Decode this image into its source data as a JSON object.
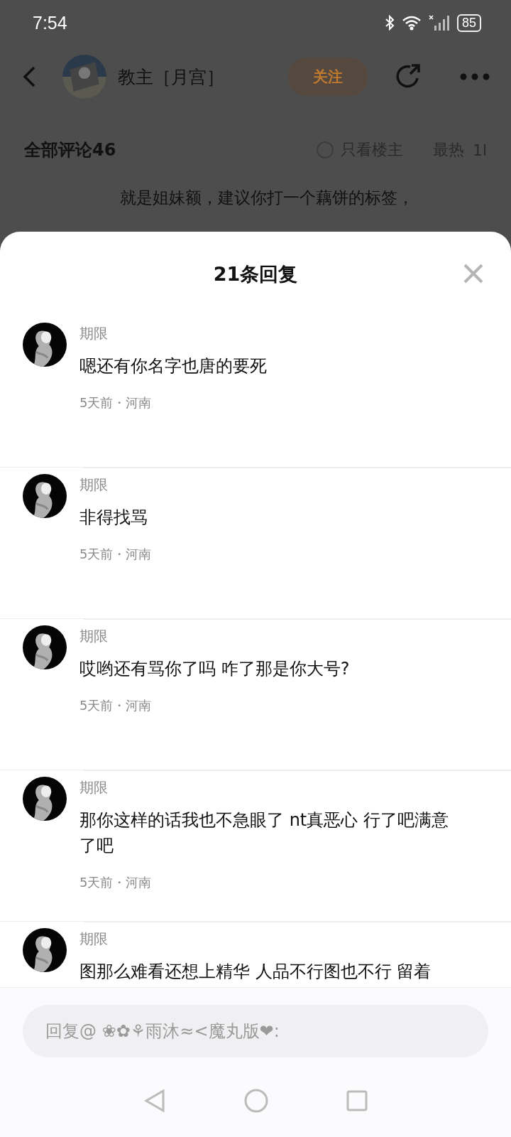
{
  "status_bar": {
    "time": "7:54",
    "battery": "85"
  },
  "header": {
    "author": "教主［月宫］",
    "follow_button": "关注"
  },
  "comments_bar": {
    "title": "全部评论46",
    "only_op": {
      "label": "只看楼主",
      "checked": false
    },
    "sort": "最热",
    "sort_cut": "1l"
  },
  "background_comment": {
    "lines": [
      "就是姐妹额，建议你打一个藕饼的标签，"
    ]
  },
  "sheet": {
    "title": "21条回复",
    "replies": [
      {
        "name": "期限",
        "text": "嗯还有你名字也唐的要死",
        "meta": "5天前・河南"
      },
      {
        "name": "期限",
        "text": "非得找骂",
        "meta": "5天前・河南"
      },
      {
        "name": "期限",
        "text": "哎哟还有骂你了吗 咋了那是你大号?",
        "meta": "5天前・河南"
      },
      {
        "name": "期限",
        "text": "那你这样的话我也不急眼了 nt真恶心 行了吧满意了吧",
        "meta": "5天前・河南"
      },
      {
        "name": "期限",
        "text": "图那么难看还想上精华 人品不行图也不行 留着"
      }
    ]
  },
  "reply_input": {
    "placeholder": "回复@ ❀✿⚘雨沐≈<魔丸版❤:"
  }
}
